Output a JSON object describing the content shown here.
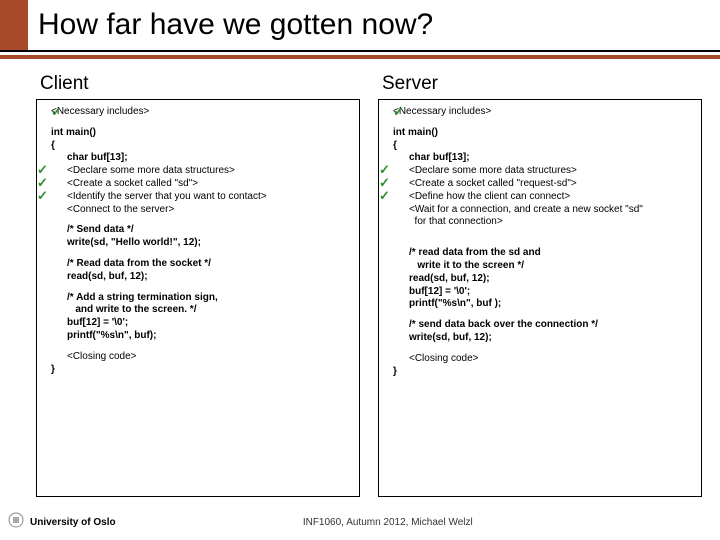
{
  "title": "How far have we gotten now?",
  "client": {
    "header": "Client",
    "includes": "<Necessary includes>",
    "main_open": "int main()\n{",
    "buf_decl": "char buf[13];",
    "ds": "<Declare some more data structures>",
    "sock": "<Create a socket called \"sd\">",
    "ident": "<Identify the server that you want to contact>",
    "connect": "<Connect to the server>",
    "send": "/* Send data */\nwrite(sd, \"Hello world!\", 12);",
    "read": "/* Read data from the socket */\nread(sd, buf, 12);",
    "term": "/* Add a string termination sign,\n   and write to the screen. */\nbuf[12] = '\\0';\nprintf(\"%s\\n\", buf);",
    "closing": "<Closing code>",
    "brace": "}"
  },
  "server": {
    "header": "Server",
    "includes": "<Necessary includes>",
    "main_open": "int main()\n{",
    "buf_decl": "char buf[13];",
    "ds": "<Declare some more data structures>",
    "sock": "<Create a socket called \"request-sd\">",
    "define": "<Define how the client can connect>",
    "wait": "<Wait for a connection, and create a new socket \"sd\"\n  for that connection>",
    "read": "/* read data from the sd and\n   write it to the screen */\nread(sd, buf, 12);\nbuf[12] = '\\0';\nprintf(\"%s\\n\", buf );",
    "send": "/* send data back over the connection */\nwrite(sd, buf, 12);",
    "closing": "<Closing code>",
    "brace": "}"
  },
  "footer": {
    "uni": "University of Oslo",
    "mid": "INF1060, Autumn 2012, Michael Welzl"
  }
}
